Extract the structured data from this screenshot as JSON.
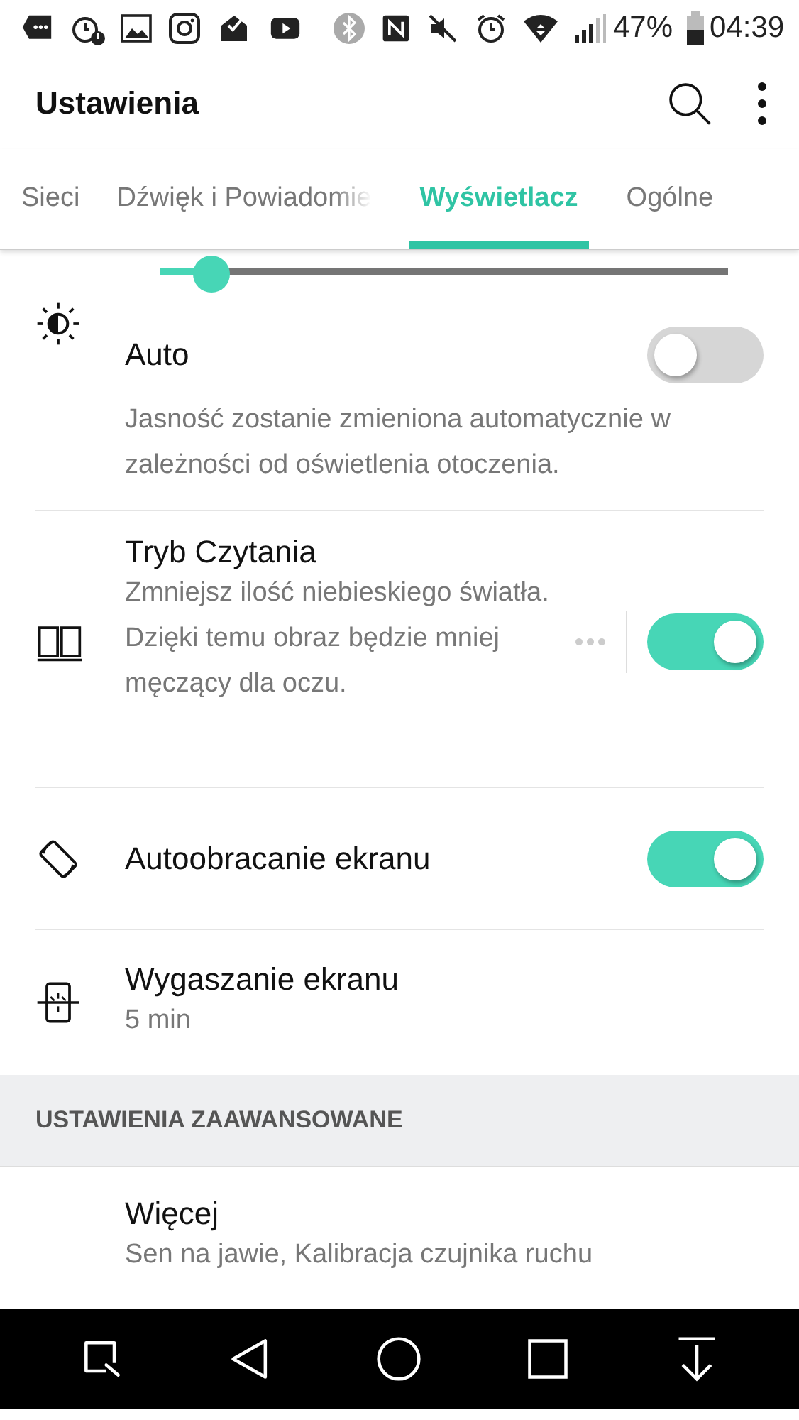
{
  "status_bar": {
    "battery": "47%",
    "time": "04:39"
  },
  "toolbar": {
    "title": "Ustawienia"
  },
  "tabs": [
    {
      "label": "Sieci",
      "selected": false
    },
    {
      "label": "Dźwięk i Powiadomie",
      "selected": false
    },
    {
      "label": "Wyświetlacz",
      "selected": true
    },
    {
      "label": "Ogólne",
      "selected": false
    }
  ],
  "brightness": {
    "level": 0.09
  },
  "settings": [
    {
      "kind": "auto",
      "title": "Auto",
      "description": "Jasność zostanie zmieniona automatycznie w zależności od oświetlenia otoczenia.",
      "on": false
    },
    {
      "kind": "reading",
      "title": "Tryb Czytania",
      "description": "Zmniejsz ilość niebieskiego światła. Dzięki temu obraz będzie mniej męczący dla oczu.",
      "on": true
    },
    {
      "kind": "rotate",
      "title": "Autoobracanie ekranu",
      "on": true
    },
    {
      "kind": "timeout",
      "title": "Wygaszanie ekranu",
      "summary": "5 min"
    }
  ],
  "section_header": "USTAWIENIA ZAAWANSOWANE",
  "more": {
    "title": "Więcej",
    "summary": "Sen na jawie, Kalibracja czujnika ruchu"
  }
}
